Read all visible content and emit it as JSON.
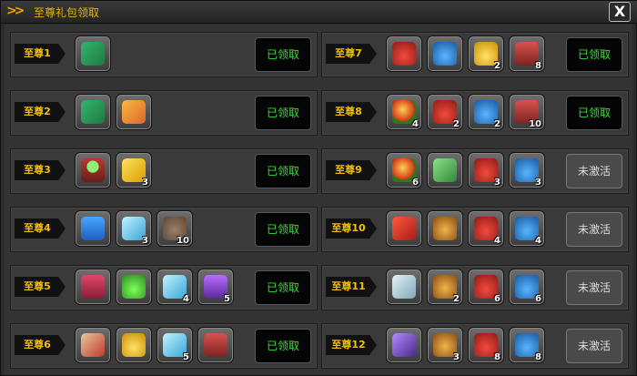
{
  "window": {
    "title": "至尊礼包领取",
    "title_arrows": ">>",
    "close_label": "X",
    "accent_color": "#f3a000"
  },
  "colors": {
    "claimed_text": "#33e033",
    "inactive_text": "#dddddd",
    "tier_text": "#f0c000"
  },
  "left_rows": [
    {
      "tier": "至尊1",
      "status": "已领取",
      "status_key": "claimed",
      "rewards": [
        {
          "icon": "green-ticket-icon",
          "cls": "icon-ticket",
          "qty": ""
        }
      ]
    },
    {
      "tier": "至尊2",
      "status": "已领取",
      "status_key": "claimed",
      "rewards": [
        {
          "icon": "green-ticket-icon",
          "cls": "icon-ticket",
          "qty": ""
        },
        {
          "icon": "orange-ticket-icon",
          "cls": "icon-orange-ticket",
          "qty": ""
        }
      ]
    },
    {
      "tier": "至尊3",
      "status": "已领取",
      "status_key": "claimed",
      "rewards": [
        {
          "icon": "gem-pedestal-icon",
          "cls": "icon-gem-pedestal",
          "qty": ""
        },
        {
          "icon": "gold-scroll-icon",
          "cls": "icon-gold-scroll",
          "qty": "3"
        }
      ]
    },
    {
      "tier": "至尊4",
      "status": "已领取",
      "status_key": "claimed",
      "rewards": [
        {
          "icon": "blue-bag-icon",
          "cls": "icon-blue-bag",
          "qty": ""
        },
        {
          "icon": "blue-crystal-icon",
          "cls": "icon-blue-crystal",
          "qty": "3"
        },
        {
          "icon": "stone-pouch-icon",
          "cls": "icon-stone-pouch",
          "qty": "10"
        }
      ]
    },
    {
      "tier": "至尊5",
      "status": "已领取",
      "status_key": "claimed",
      "rewards": [
        {
          "icon": "pink-bag-icon",
          "cls": "icon-pink-bag",
          "qty": ""
        },
        {
          "icon": "green-potion-icon",
          "cls": "icon-green-potion",
          "qty": ""
        },
        {
          "icon": "blue-crystal-icon",
          "cls": "icon-blue-crystal",
          "qty": "4"
        },
        {
          "icon": "purple-chest-icon",
          "cls": "icon-purple-chest",
          "qty": "5"
        }
      ]
    },
    {
      "tier": "至尊6",
      "status": "已领取",
      "status_key": "claimed",
      "rewards": [
        {
          "icon": "vip-card-icon",
          "cls": "icon-vip-card",
          "qty": ""
        },
        {
          "icon": "gold-potion-icon",
          "cls": "icon-gold-potion",
          "qty": ""
        },
        {
          "icon": "blue-crystal-icon",
          "cls": "icon-blue-crystal",
          "qty": "5"
        },
        {
          "icon": "red-chest-icon",
          "cls": "icon-red-chest",
          "qty": ""
        }
      ]
    }
  ],
  "right_rows": [
    {
      "tier": "至尊7",
      "status": "已领取",
      "status_key": "claimed",
      "rewards": [
        {
          "icon": "red-pouch-icon",
          "cls": "icon-red-pouch",
          "qty": ""
        },
        {
          "icon": "blue-pouch-icon",
          "cls": "icon-blue-pouch",
          "qty": ""
        },
        {
          "icon": "gold-potion-icon",
          "cls": "icon-gold-potion",
          "qty": "2"
        },
        {
          "icon": "red-chest-icon",
          "cls": "icon-red-chest",
          "qty": "8"
        }
      ]
    },
    {
      "tier": "至尊8",
      "status": "已领取",
      "status_key": "claimed",
      "rewards": [
        {
          "icon": "orange-orb-icon",
          "cls": "icon-orange-orb",
          "qty": "4"
        },
        {
          "icon": "red-pouch-icon",
          "cls": "icon-red-pouch",
          "qty": "2"
        },
        {
          "icon": "blue-pouch-icon",
          "cls": "icon-blue-pouch",
          "qty": "2"
        },
        {
          "icon": "red-chest-icon",
          "cls": "icon-red-chest",
          "qty": "10"
        }
      ]
    },
    {
      "tier": "至尊9",
      "status": "未激活",
      "status_key": "inactive",
      "rewards": [
        {
          "icon": "orange-orb-icon",
          "cls": "icon-orange-orb",
          "qty": "6"
        },
        {
          "icon": "green-vip-card-icon",
          "cls": "icon-green-vip-card",
          "qty": ""
        },
        {
          "icon": "red-pouch-icon",
          "cls": "icon-red-pouch",
          "qty": "3"
        },
        {
          "icon": "blue-pouch-icon",
          "cls": "icon-blue-pouch",
          "qty": "3"
        }
      ]
    },
    {
      "tier": "至尊10",
      "status": "未激活",
      "status_key": "inactive",
      "rewards": [
        {
          "icon": "red-book-icon",
          "cls": "icon-red-book",
          "qty": ""
        },
        {
          "icon": "gold-pot-icon",
          "cls": "icon-gold-pot",
          "qty": ""
        },
        {
          "icon": "red-pouch-icon",
          "cls": "icon-red-pouch",
          "qty": "4"
        },
        {
          "icon": "blue-pouch-icon",
          "cls": "icon-blue-pouch",
          "qty": "4"
        }
      ]
    },
    {
      "tier": "至尊11",
      "status": "未激活",
      "status_key": "inactive",
      "rewards": [
        {
          "icon": "silver-book-icon",
          "cls": "icon-silver-book",
          "qty": ""
        },
        {
          "icon": "gold-pot-icon",
          "cls": "icon-gold-pot",
          "qty": "2"
        },
        {
          "icon": "red-pouch-icon",
          "cls": "icon-red-pouch",
          "qty": "6"
        },
        {
          "icon": "blue-pouch-icon",
          "cls": "icon-blue-pouch",
          "qty": "6"
        }
      ]
    },
    {
      "tier": "至尊12",
      "status": "未激活",
      "status_key": "inactive",
      "rewards": [
        {
          "icon": "purple-book-icon",
          "cls": "icon-purple-book",
          "qty": ""
        },
        {
          "icon": "gold-pot-icon",
          "cls": "icon-gold-pot",
          "qty": "3"
        },
        {
          "icon": "red-pouch-icon",
          "cls": "icon-red-pouch",
          "qty": "8"
        },
        {
          "icon": "blue-pouch-icon",
          "cls": "icon-blue-pouch",
          "qty": "8"
        }
      ]
    }
  ]
}
